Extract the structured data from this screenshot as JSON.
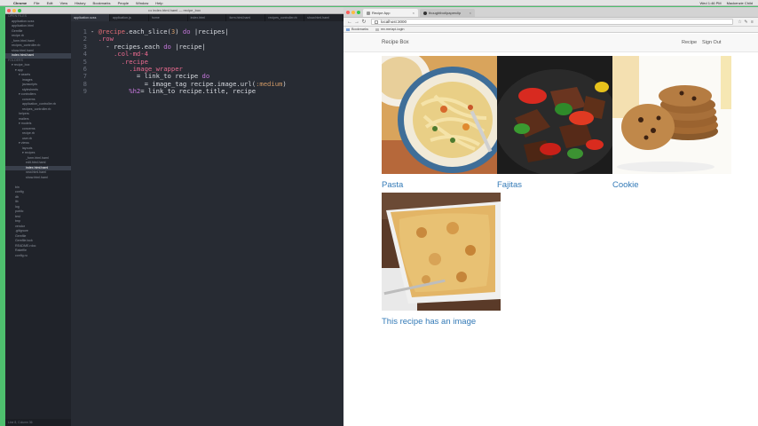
{
  "menubar": {
    "items": [
      "Chrome",
      "File",
      "Edit",
      "View",
      "History",
      "Bookmarks",
      "People",
      "Window",
      "Help"
    ],
    "right": [
      "Wed 1:46 PM",
      "Mackenzie Child"
    ]
  },
  "editor": {
    "title": "••• index.html.haml — recipe_box",
    "tabs": [
      "application.scss",
      "application.js",
      "home",
      "index.html",
      "form.html.haml",
      "recipes_controller.rb",
      "show.html.haml"
    ],
    "sidebar": [
      {
        "label": "OPEN FILES",
        "indent": 0,
        "hdr": true
      },
      {
        "label": "application.scss",
        "indent": 1
      },
      {
        "label": "application.html",
        "indent": 1
      },
      {
        "label": "Gemfile",
        "indent": 1
      },
      {
        "label": "recipe.rb",
        "indent": 1
      },
      {
        "label": "_form.html.haml",
        "indent": 1
      },
      {
        "label": "recipes_controller.rb",
        "indent": 1
      },
      {
        "label": "show.html.haml",
        "indent": 1
      },
      {
        "label": "index.html.haml",
        "indent": 1,
        "sel": true
      },
      {
        "label": "FOLDERS",
        "indent": 0,
        "hdr": true
      },
      {
        "label": "▾ recipe_box",
        "indent": 1
      },
      {
        "label": "▾ app",
        "indent": 2
      },
      {
        "label": "▾ assets",
        "indent": 3
      },
      {
        "label": "images",
        "indent": 4
      },
      {
        "label": "javascripts",
        "indent": 4
      },
      {
        "label": "stylesheets",
        "indent": 4
      },
      {
        "label": "▾ controllers",
        "indent": 3
      },
      {
        "label": "concerns",
        "indent": 4
      },
      {
        "label": "application_controller.rb",
        "indent": 4
      },
      {
        "label": "recipes_controller.rb",
        "indent": 4
      },
      {
        "label": "helpers",
        "indent": 3
      },
      {
        "label": "mailers",
        "indent": 3
      },
      {
        "label": "▾ models",
        "indent": 3
      },
      {
        "label": "concerns",
        "indent": 4
      },
      {
        "label": "recipe.rb",
        "indent": 4
      },
      {
        "label": "user.rb",
        "indent": 4
      },
      {
        "label": "▾ views",
        "indent": 3
      },
      {
        "label": "layouts",
        "indent": 4
      },
      {
        "label": "▾ recipes",
        "indent": 4
      },
      {
        "label": "_form.html.haml",
        "indent": 5
      },
      {
        "label": "edit.html.haml",
        "indent": 5
      },
      {
        "label": "index.html.haml",
        "indent": 5,
        "sel": true
      },
      {
        "label": "new.html.haml",
        "indent": 5
      },
      {
        "label": "show.html.haml",
        "indent": 5
      },
      {
        "label": "",
        "indent": 0
      },
      {
        "label": "bin",
        "indent": 2
      },
      {
        "label": "config",
        "indent": 2
      },
      {
        "label": "db",
        "indent": 2
      },
      {
        "label": "lib",
        "indent": 2
      },
      {
        "label": "log",
        "indent": 2
      },
      {
        "label": "public",
        "indent": 2
      },
      {
        "label": "test",
        "indent": 2
      },
      {
        "label": "tmp",
        "indent": 2
      },
      {
        "label": "vendor",
        "indent": 2
      },
      {
        "label": ".gitignore",
        "indent": 2
      },
      {
        "label": "Gemfile",
        "indent": 2
      },
      {
        "label": "Gemfile.lock",
        "indent": 2
      },
      {
        "label": "README.rdoc",
        "indent": 2
      },
      {
        "label": "Rakefile",
        "indent": 2
      },
      {
        "label": "config.ru",
        "indent": 2
      }
    ],
    "status": "Line 8, Column 36",
    "code": [
      {
        "n": "1",
        "tokens": [
          [
            "plain",
            "- "
          ],
          [
            "id",
            "@recipe"
          ],
          [
            "plain",
            ".each_slice("
          ],
          [
            "sym",
            "3"
          ],
          [
            "plain",
            ") "
          ],
          [
            "kw",
            "do"
          ],
          [
            "plain",
            " |recipes|"
          ]
        ]
      },
      {
        "n": "2",
        "tokens": [
          [
            "plain",
            "  "
          ],
          [
            "pink",
            ".row"
          ]
        ]
      },
      {
        "n": "3",
        "tokens": [
          [
            "plain",
            "    - recipes.each "
          ],
          [
            "kw",
            "do"
          ],
          [
            "plain",
            " |recipe|"
          ]
        ]
      },
      {
        "n": "4",
        "tokens": [
          [
            "plain",
            "      "
          ],
          [
            "pink",
            ".col-md-4"
          ]
        ]
      },
      {
        "n": "5",
        "tokens": [
          [
            "plain",
            "        "
          ],
          [
            "pink",
            ".recipe"
          ]
        ]
      },
      {
        "n": "6",
        "tokens": [
          [
            "plain",
            "          "
          ],
          [
            "pink",
            ".image_wrapper"
          ]
        ]
      },
      {
        "n": "7",
        "tokens": [
          [
            "plain",
            "            = link_to recipe "
          ],
          [
            "kw",
            "do"
          ]
        ]
      },
      {
        "n": "8",
        "tokens": [
          [
            "plain",
            "              = image_tag recipe.image.url("
          ],
          [
            "sym",
            ":medium"
          ],
          [
            "plain",
            ")"
          ]
        ]
      },
      {
        "n": "9",
        "tokens": [
          [
            "plain",
            "          "
          ],
          [
            "kw",
            "%h2"
          ],
          [
            "plain",
            "= link_to recipe.title, recipe"
          ]
        ]
      }
    ]
  },
  "browser": {
    "tabs": [
      "Recipe App",
      "thoughtbot/paperclip",
      ""
    ],
    "url": "localhost:3000",
    "bookmarks": [
      "Bookmarks",
      "mv.me/api-login"
    ],
    "brand": "Recipe Box",
    "nav": [
      "Recipe",
      "Sign Out"
    ],
    "recipes": [
      {
        "title": "Pasta",
        "image": "pasta-image"
      },
      {
        "title": "Fajitas",
        "image": "fajitas-image"
      },
      {
        "title": "Cookie",
        "image": "cookie-image"
      },
      {
        "title": "This recipe has an image",
        "image": "mac-and-cheese-image"
      }
    ]
  },
  "colors": {
    "desktop": "#4ec06e",
    "editor_bg": "#272b33",
    "link": "#337ab7"
  }
}
